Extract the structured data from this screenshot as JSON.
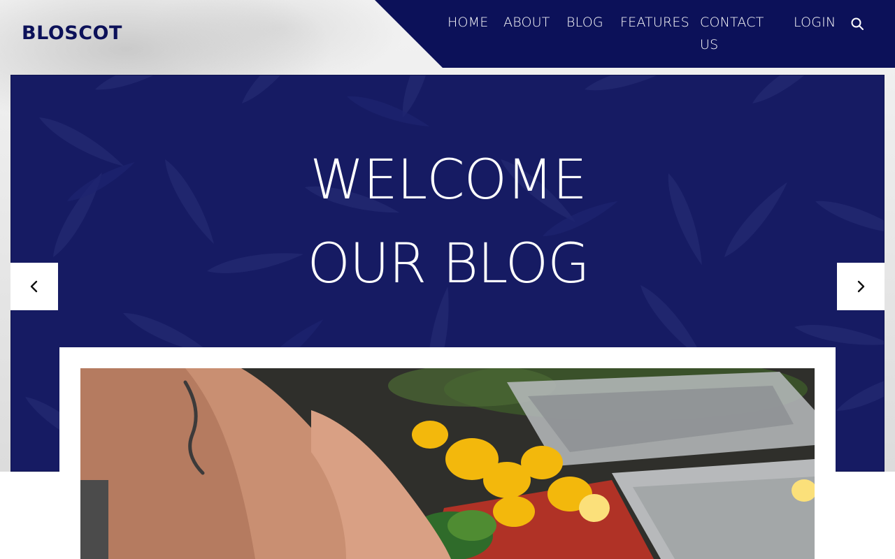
{
  "brand": {
    "logo_text": "BLOSCOT",
    "nav_color": "#0c1159"
  },
  "nav": {
    "items": [
      "HOME",
      "ABOUT",
      "BLOG",
      "FEATURES",
      "CONTACT US",
      "LOGIN"
    ]
  },
  "icons": {
    "search": "search-icon",
    "prev": "chevron-left-icon",
    "next": "chevron-right-icon"
  },
  "hero": {
    "title_line1": "WELCOME",
    "title_line2": "OUR BLOG",
    "background_color": "#161b63"
  },
  "featured": {
    "image_subject": "chef-preparing-vegetables-photo"
  }
}
